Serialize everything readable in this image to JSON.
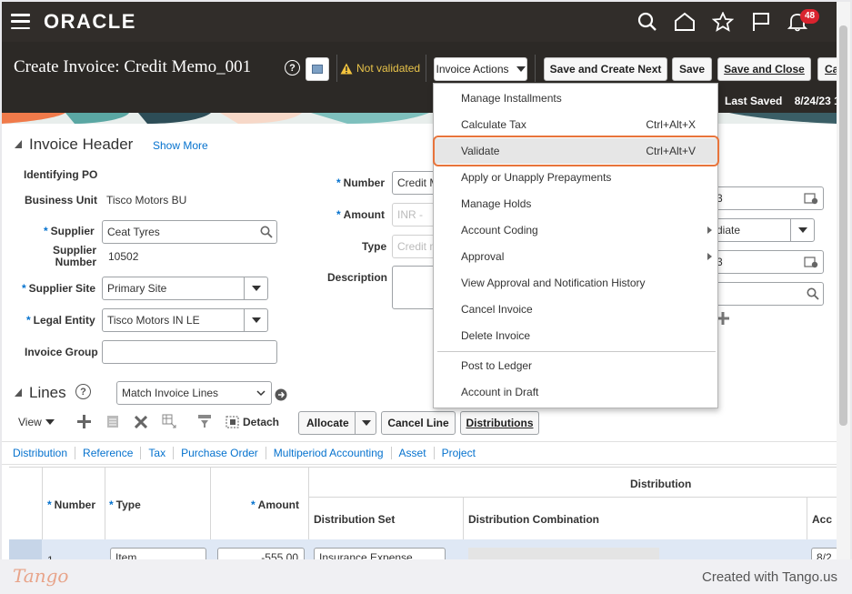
{
  "app": {
    "logo": "ORACLE",
    "notifications_count": "48"
  },
  "header": {
    "title": "Create Invoice: Credit Memo_001",
    "status": "Not validated",
    "invoice_actions_label": "Invoice Actions",
    "buttons": {
      "save_create_next": "Save and Create Next",
      "save": "Save",
      "save_close": "Save and Close",
      "cancel": "Ca"
    },
    "last_saved_label": "Last Saved",
    "last_saved_value": "8/24/23 1:"
  },
  "invoice_header": {
    "title": "Invoice Header",
    "show_more": "Show More",
    "identifying_po_label": "Identifying PO",
    "business_unit_label": "Business Unit",
    "business_unit_value": "Tisco Motors BU",
    "supplier_label": "Supplier",
    "supplier_value": "Ceat Tyres",
    "supplier_number_label_1": "Supplier",
    "supplier_number_label_2": "Number",
    "supplier_number_value": "10502",
    "supplier_site_label": "Supplier Site",
    "supplier_site_value": "Primary Site",
    "legal_entity_label": "Legal Entity",
    "legal_entity_value": "Tisco Motors IN LE",
    "invoice_group_label": "Invoice Group",
    "number_label": "Number",
    "number_value": "Credit M",
    "amount_label": "Amount",
    "amount_currency": "INR -",
    "type_label": "Type",
    "type_value": "Credit m",
    "description_label": "Description",
    "right_date_1": "3",
    "right_select": "diate",
    "right_date_2": "3"
  },
  "lines": {
    "title": "Lines",
    "match_select": "Match Invoice Lines",
    "view_label": "View",
    "detach_label": "Detach",
    "allocate_label": "Allocate",
    "cancel_line_label": "Cancel Line",
    "distributions_label": "Distributions",
    "tabs": [
      "Distribution",
      "Reference",
      "Tax",
      "Purchase Order",
      "Multiperiod Accounting",
      "Asset",
      "Project"
    ],
    "columns": {
      "number": "Number",
      "type": "Type",
      "amount": "Amount",
      "distribution_group": "Distribution",
      "distribution_set": "Distribution Set",
      "distribution_combination": "Distribution Combination",
      "acc": "Acc"
    },
    "row": {
      "number": "1",
      "type": "Item",
      "amount": "-555.00",
      "distribution_set": "Insurance Expense",
      "acc": "8/2"
    }
  },
  "menu": {
    "items": [
      {
        "label": "Manage Installments",
        "shortcut": ""
      },
      {
        "label": "Calculate Tax",
        "shortcut": "Ctrl+Alt+X"
      },
      {
        "label": "Validate",
        "shortcut": "Ctrl+Alt+V"
      },
      {
        "label": "Apply or Unapply Prepayments",
        "shortcut": ""
      },
      {
        "label": "Manage Holds",
        "shortcut": ""
      },
      {
        "label": "Account Coding",
        "shortcut": ""
      },
      {
        "label": "Approval",
        "shortcut": ""
      },
      {
        "label": "View Approval and Notification History",
        "shortcut": ""
      },
      {
        "label": "Cancel Invoice",
        "shortcut": ""
      },
      {
        "label": "Delete Invoice",
        "shortcut": ""
      },
      {
        "label": "Post to Ledger",
        "shortcut": ""
      },
      {
        "label": "Account in Draft",
        "shortcut": ""
      }
    ]
  },
  "footer": {
    "brand": "Tango",
    "created_with": "Created with Tango.us"
  },
  "colors": {
    "topbar": "#312d2a",
    "link": "#0572ce",
    "highlight": "#e8743b",
    "warning": "#e8c34a"
  }
}
